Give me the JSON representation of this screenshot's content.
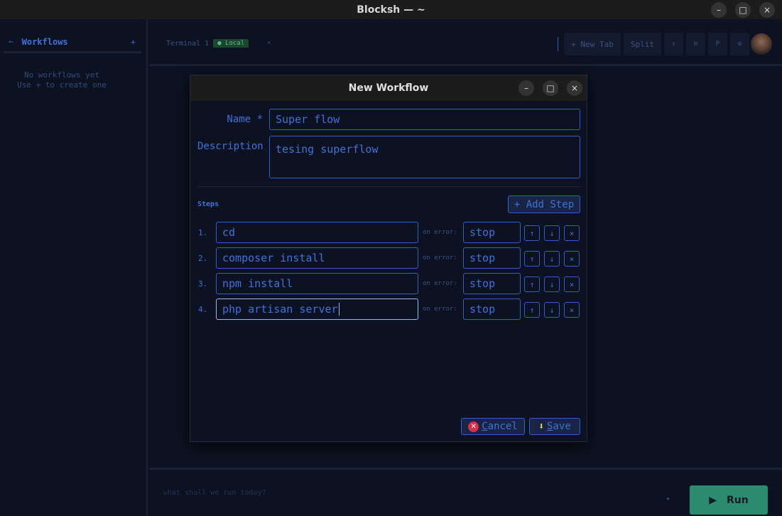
{
  "window": {
    "title": "Blocksh — ~",
    "minimize": "–",
    "maximize": "□",
    "close": "×"
  },
  "sidebar": {
    "back": "←",
    "title": "Workflows",
    "add": "+",
    "empty_line1": "No workflows yet",
    "empty_line2": "Use + to create one"
  },
  "header": {
    "tab_label": "Terminal 1",
    "tab_badge": "● Local",
    "tab_close": "×",
    "new_tab": "+ New Tab",
    "split": "Split",
    "tool_icon_1": "↕",
    "tool_icon_2": "⊟",
    "tool_icon_3": "P",
    "tool_icon_4": "⚙"
  },
  "dialog": {
    "title": "New Workflow",
    "minimize": "–",
    "maximize": "□",
    "close": "×",
    "name_label": "Name *",
    "name_value": "Super flow",
    "description_label": "Description",
    "description_value": "tesing superflow",
    "steps_label": "Steps",
    "add_step": "+ Add Step",
    "on_error_label": "on error:",
    "steps": [
      {
        "num": "1.",
        "command": "cd",
        "on_error": "stop"
      },
      {
        "num": "2.",
        "command": "composer install",
        "on_error": "stop"
      },
      {
        "num": "3.",
        "command": "npm install",
        "on_error": "stop"
      },
      {
        "num": "4.",
        "command": "php artisan server",
        "on_error": "stop"
      }
    ],
    "up": "↑",
    "down": "↓",
    "remove": "×",
    "cancel_first": "C",
    "cancel_rest": "ancel",
    "save_first": "S",
    "save_rest": "ave"
  },
  "bottom": {
    "prompt_placeholder": "what shall we run today?",
    "sparkle": "✦",
    "run_icon": "▶",
    "run_label": "Run"
  }
}
